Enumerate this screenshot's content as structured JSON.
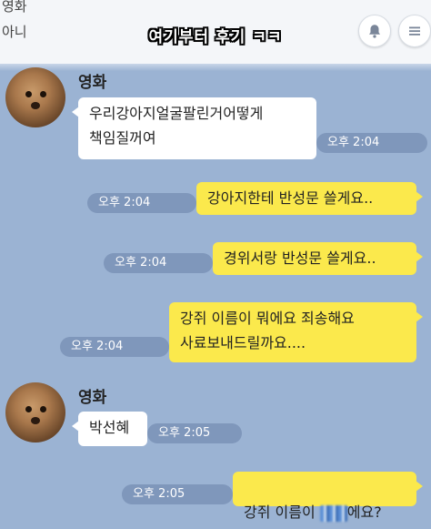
{
  "header": {
    "fragment_top": "영화",
    "fragment_bottom": "아니",
    "caption": "여기부터 후기 ㅋㅋ"
  },
  "icons": {
    "bell": "bell-icon",
    "menu": "menu-icon"
  },
  "colors": {
    "background": "#9bb3d3",
    "yellow_bubble": "#fbe94c",
    "white_bubble": "#ffffff"
  },
  "messages": [
    {
      "sender": "영화",
      "text": "우리강아지얼굴팔린거어떻게\n책임질꺼여",
      "time": "오후 2:04"
    },
    {
      "text": "강아지한테 반성문 쓸게요..",
      "time": "오후 2:04"
    },
    {
      "text": "경위서랑 반성문 쓸게요..",
      "time": "오후 2:04"
    },
    {
      "text": "강쥐 이름이 뭐에요 죄송해요\n사료보내드릴까요....",
      "time": "오후 2:04"
    },
    {
      "sender": "영화",
      "text": "박선혜",
      "time": "오후 2:05"
    },
    {
      "text_before": "강쥐 이름이 ",
      "text_after": "에요?",
      "time": "오후 2:05"
    }
  ]
}
